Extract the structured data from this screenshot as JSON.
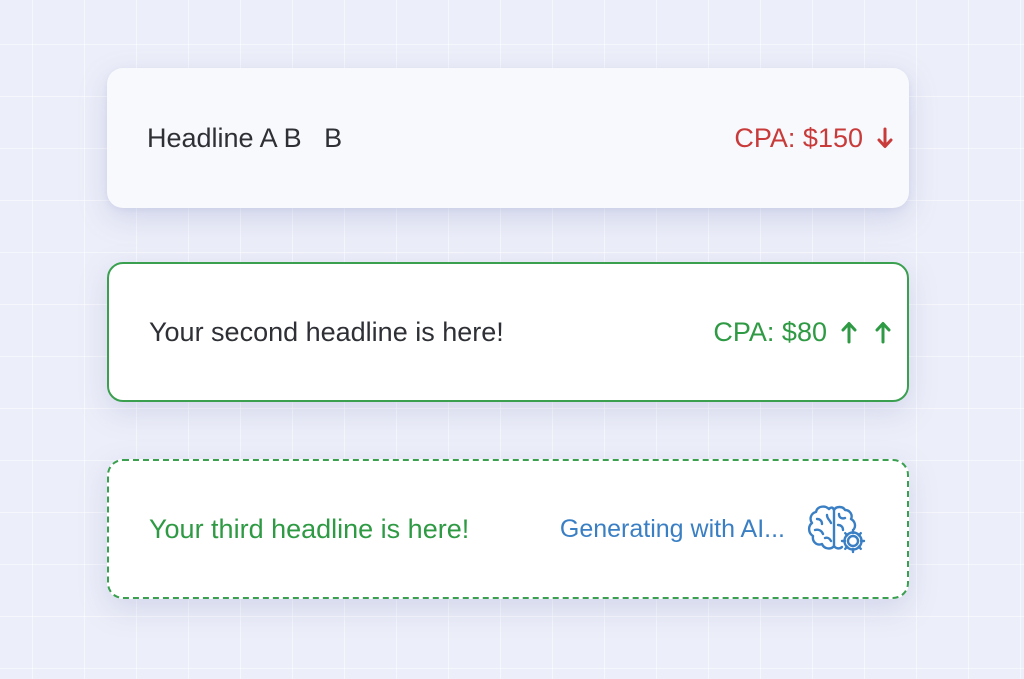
{
  "headline_cards": [
    {
      "headline": "Headline A B   B",
      "cpa_text": "CPA: $150",
      "trend_icons": [
        "arrow-down-icon"
      ],
      "status_color": "#c93a3a"
    },
    {
      "headline": "Your second headline is here!",
      "cpa_text": "CPA: $80",
      "trend_icons": [
        "arrow-up-icon",
        "arrow-up-icon"
      ],
      "status_color": "#2f9a44"
    },
    {
      "headline": "Your third headline is here!",
      "status_text": "Generating with AI...",
      "status_icon": "ai-brain-gear-icon",
      "status_color": "#3a7fc4"
    }
  ],
  "colors": {
    "background": "#eceef9",
    "positive": "#2f9a44",
    "negative": "#c93a3a",
    "ai": "#3a7fc4"
  }
}
